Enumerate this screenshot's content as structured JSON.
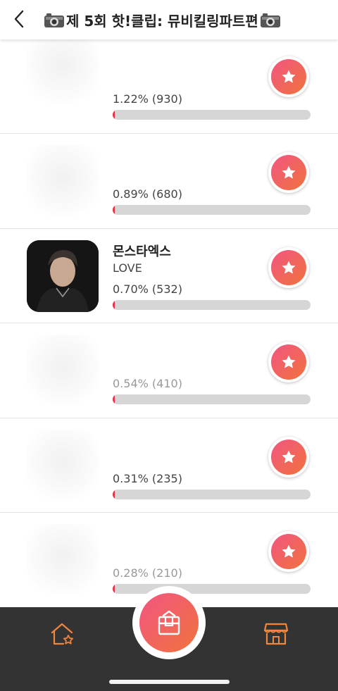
{
  "header": {
    "title": "제 5회 핫!클립: 뮤비킬링파트편"
  },
  "rankings": [
    {
      "name": "",
      "song": "",
      "percent_text": "1.22% (930)",
      "fraction": 0.0122,
      "thumb": "blurred"
    },
    {
      "name": "",
      "song": "",
      "percent_text": "0.89% (680)",
      "fraction": 0.0089,
      "thumb": "blurred"
    },
    {
      "name": "몬스타엑스",
      "song": "LOVE",
      "percent_text": "0.70% (532)",
      "fraction": 0.007,
      "thumb": "photo"
    },
    {
      "name": "",
      "song": "",
      "percent_text": "0.54% (410)",
      "fraction": 0.0054,
      "thumb": "blurred"
    },
    {
      "name": "",
      "song": "",
      "percent_text": "0.31% (235)",
      "fraction": 0.0031,
      "thumb": "blurred"
    },
    {
      "name": "",
      "song": "",
      "percent_text": "0.28% (210)",
      "fraction": 0.0028,
      "thumb": "blurred"
    }
  ],
  "colors": {
    "accent_start": "#f25582",
    "accent_end": "#f0733c",
    "bar_fill": "#e6344a",
    "bar_track": "#d6d6d6",
    "nav_bg": "#333333",
    "nav_icon": "#f0853c"
  },
  "icons": {
    "back": "chevron-left-icon",
    "title_decoration": "camera-icon",
    "vote": "star-icon",
    "nav_home": "home-star-icon",
    "nav_center": "box-icon",
    "nav_store": "store-icon"
  }
}
